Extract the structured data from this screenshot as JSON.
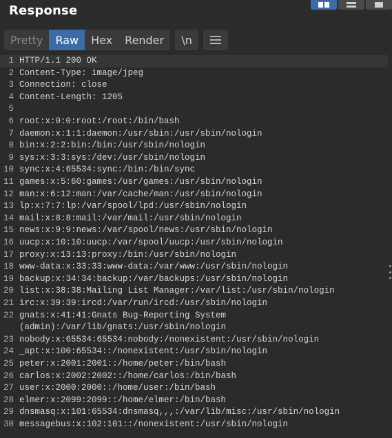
{
  "panel": {
    "title": "Response"
  },
  "layout_buttons": [
    {
      "name": "split-view-icon",
      "active": true
    },
    {
      "name": "horizontal-view-icon",
      "active": false
    },
    {
      "name": "single-view-icon",
      "active": false
    }
  ],
  "tabs": {
    "pretty": "Pretty",
    "raw": "Raw",
    "hex": "Hex",
    "render": "Render",
    "newline": "\\n"
  },
  "lines": [
    {
      "n": "1",
      "text": "HTTP/1.1 200 OK"
    },
    {
      "n": "2",
      "text": "Content-Type: image/jpeg"
    },
    {
      "n": "3",
      "text": "Connection: close"
    },
    {
      "n": "4",
      "text": "Content-Length: 1205"
    },
    {
      "n": "5",
      "text": ""
    },
    {
      "n": "6",
      "text": "root:x:0:0:root:/root:/bin/bash"
    },
    {
      "n": "7",
      "text": "daemon:x:1:1:daemon:/usr/sbin:/usr/sbin/nologin"
    },
    {
      "n": "8",
      "text": "bin:x:2:2:bin:/bin:/usr/sbin/nologin"
    },
    {
      "n": "9",
      "text": "sys:x:3:3:sys:/dev:/usr/sbin/nologin"
    },
    {
      "n": "10",
      "text": "sync:x:4:65534:sync:/bin:/bin/sync"
    },
    {
      "n": "11",
      "text": "games:x:5:60:games:/usr/games:/usr/sbin/nologin"
    },
    {
      "n": "12",
      "text": "man:x:6:12:man:/var/cache/man:/usr/sbin/nologin"
    },
    {
      "n": "13",
      "text": "lp:x:7:7:lp:/var/spool/lpd:/usr/sbin/nologin"
    },
    {
      "n": "14",
      "text": "mail:x:8:8:mail:/var/mail:/usr/sbin/nologin"
    },
    {
      "n": "15",
      "text": "news:x:9:9:news:/var/spool/news:/usr/sbin/nologin"
    },
    {
      "n": "16",
      "text": "uucp:x:10:10:uucp:/var/spool/uucp:/usr/sbin/nologin"
    },
    {
      "n": "17",
      "text": "proxy:x:13:13:proxy:/bin:/usr/sbin/nologin"
    },
    {
      "n": "18",
      "text": "www-data:x:33:33:www-data:/var/www:/usr/sbin/nologin"
    },
    {
      "n": "19",
      "text": "backup:x:34:34:backup:/var/backups:/usr/sbin/nologin"
    },
    {
      "n": "20",
      "text": "list:x:38:38:Mailing List Manager:/var/list:/usr/sbin/nologin"
    },
    {
      "n": "21",
      "text": "irc:x:39:39:ircd:/var/run/ircd:/usr/sbin/nologin"
    },
    {
      "n": "22",
      "text": "gnats:x:41:41:Gnats Bug-Reporting System"
    },
    {
      "n": "",
      "text": "(admin):/var/lib/gnats:/usr/sbin/nologin"
    },
    {
      "n": "23",
      "text": "nobody:x:65534:65534:nobody:/nonexistent:/usr/sbin/nologin"
    },
    {
      "n": "24",
      "text": "_apt:x:100:65534::/nonexistent:/usr/sbin/nologin"
    },
    {
      "n": "25",
      "text": "peter:x:2001:2001::/home/peter:/bin/bash"
    },
    {
      "n": "26",
      "text": "carlos:x:2002:2002::/home/carlos:/bin/bash"
    },
    {
      "n": "27",
      "text": "user:x:2000:2000::/home/user:/bin/bash"
    },
    {
      "n": "28",
      "text": "elmer:x:2099:2099::/home/elmer:/bin/bash"
    },
    {
      "n": "29",
      "text": "dnsmasq:x:101:65534:dnsmasq,,,:/var/lib/misc:/usr/sbin/nologin"
    },
    {
      "n": "30",
      "text": "messagebus:x:102:101::/nonexistent:/usr/sbin/nologin"
    }
  ],
  "colors": {
    "background": "#2b2b2b",
    "accent": "#3c6ba5",
    "current_line": "#363636"
  }
}
